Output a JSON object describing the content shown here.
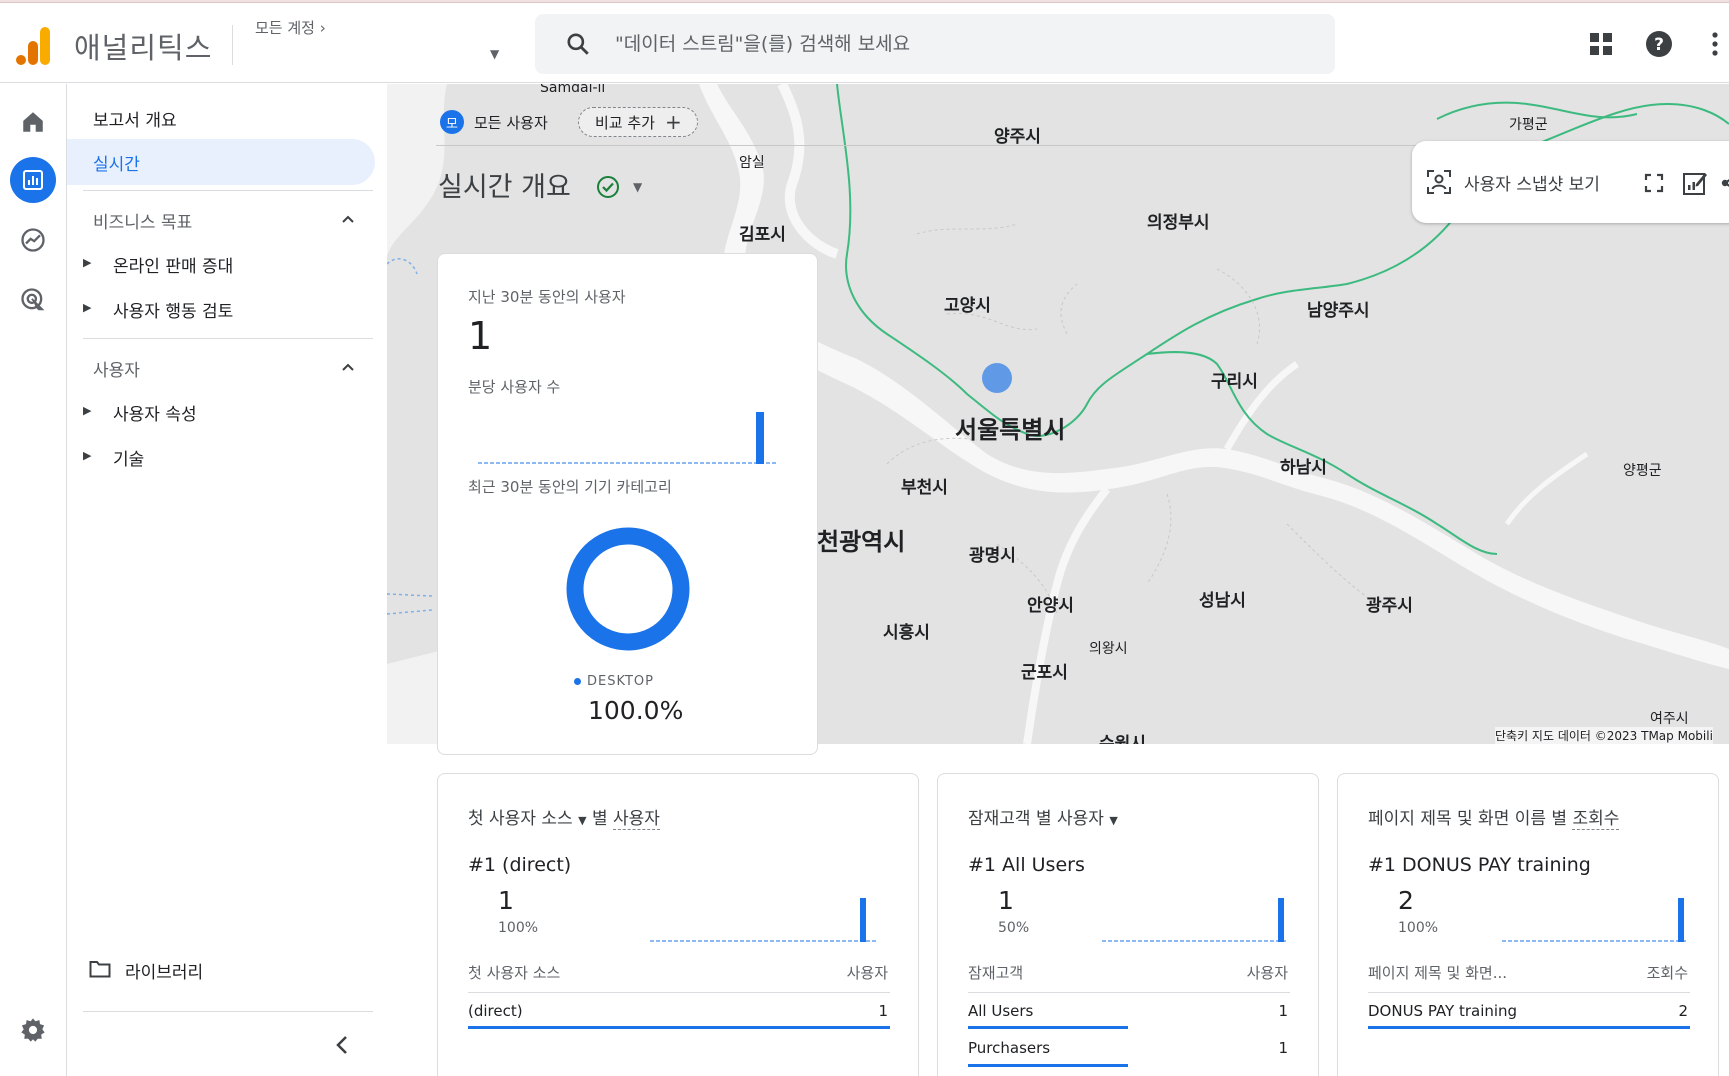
{
  "app": {
    "title": "애널리틱스",
    "account": "모든 계정"
  },
  "search": {
    "placeholder": "\"데이터 스트림\"을(를) 검색해 보세요"
  },
  "nav": {
    "overview": "보고서 개요",
    "realtime": "실시간",
    "section_business": "비즈니스 목표",
    "item_online_sales": "온라인 판매 증대",
    "item_user_behavior": "사용자 행동 검토",
    "section_user": "사용자",
    "item_user_attr": "사용자 속성",
    "item_tech": "기술",
    "library": "라이브러리"
  },
  "map": {
    "chip_user_avatar": "모",
    "chip_user": "모든 사용자",
    "chip_compare": "비교 추가",
    "title": "실시간 개요",
    "snapshot": "사용자 스냅샷 보기",
    "credit": "단축키  지도 데이터 ©2023 TMap Mobili",
    "labels": {
      "samdal": "Samdal-li",
      "yangju": "양주시",
      "gapyeong": "가평군",
      "amsil": "암실",
      "gimpo": "김포시",
      "uijeongbu": "의정부시",
      "goyang": "고양시",
      "namyangju": "남양주시",
      "guri": "구리시",
      "seoul": "서울특별시",
      "hanam": "하남시",
      "yangpyeong": "양평군",
      "bucheon": "부천시",
      "incheon": "천광역시",
      "gwangmyeong": "광명시",
      "anyang": "안양시",
      "seongnam": "성남시",
      "gwangju": "광주시",
      "siheung": "시흥시",
      "uiwang": "의왕시",
      "gunpo": "군포시",
      "yeoju": "여주시",
      "suwon": "수원시"
    }
  },
  "realtime_card": {
    "users_label": "지난 30분 동안의 사용자",
    "users_value": "1",
    "per_min_label": "분당 사용자 수",
    "device_label": "최근 30분 동안의 기기 카테고리",
    "legend": "DESKTOP",
    "percent": "100.0%"
  },
  "cards": [
    {
      "head_a": "첫 사용자 소스",
      "head_b": "별",
      "head_c": "사용자",
      "rank": "#1  (direct)",
      "value": "1",
      "percent": "100%",
      "col_a": "첫 사용자 소스",
      "col_b": "사용자",
      "rows": [
        {
          "label": "(direct)",
          "value": "1"
        }
      ]
    },
    {
      "head_a": "잠재고객 별 사용자",
      "rank": "#1  All Users",
      "value": "1",
      "percent": "50%",
      "col_a": "잠재고객",
      "col_b": "사용자",
      "rows": [
        {
          "label": "All Users",
          "value": "1"
        },
        {
          "label": "Purchasers",
          "value": "1"
        }
      ]
    },
    {
      "head_a": "페이지 제목 및 화면 이름 별",
      "head_c": "조회수",
      "rank": "#1  DONUS PAY training",
      "value": "2",
      "percent": "100%",
      "col_a": "페이지 제목 및 화면...",
      "col_b": "조회수",
      "rows": [
        {
          "label": "DONUS PAY training",
          "value": "2"
        }
      ]
    }
  ],
  "colors": {
    "accent": "#1a73e8",
    "river_border": "#3cba7f",
    "logo_orange": "#f9ab00",
    "logo_dark": "#e37400"
  }
}
